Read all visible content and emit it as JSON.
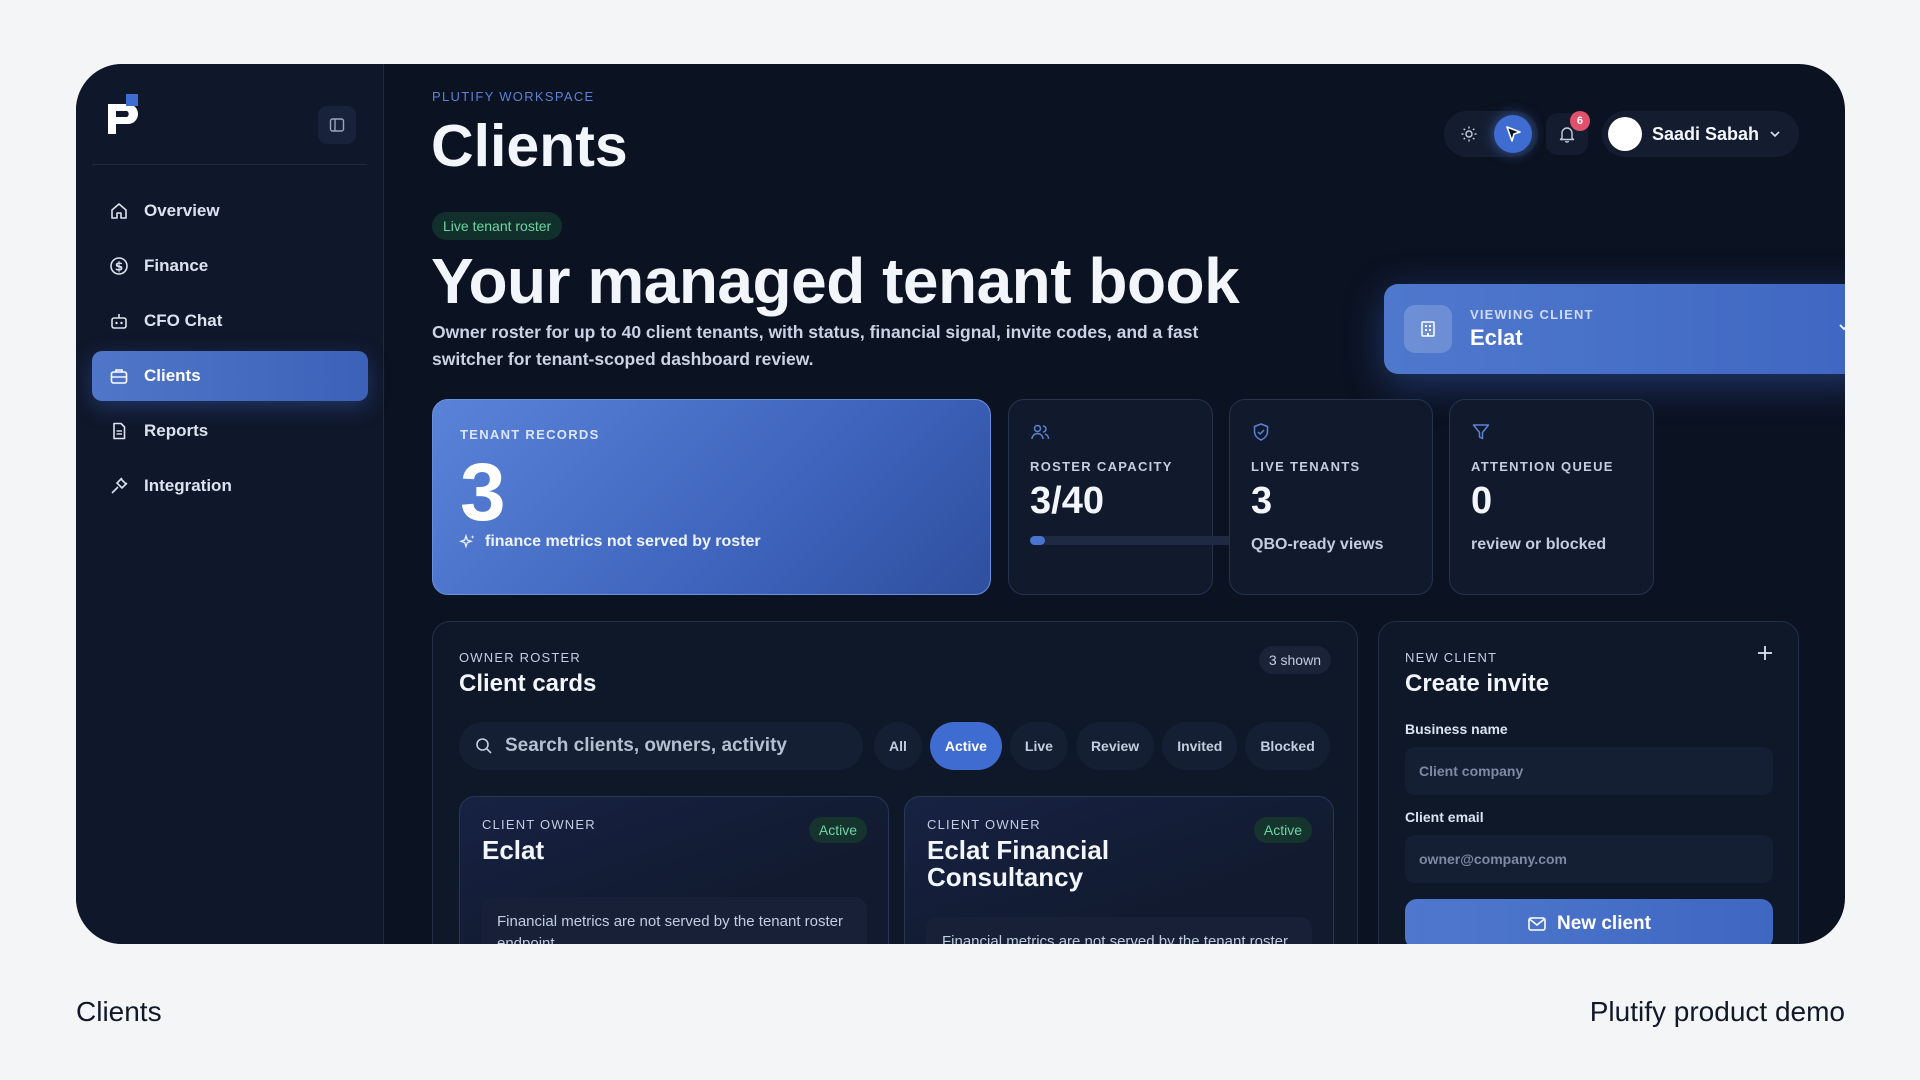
{
  "sidebar": {
    "items": [
      {
        "label": "Overview",
        "icon": "home-icon"
      },
      {
        "label": "Finance",
        "icon": "dollar-icon"
      },
      {
        "label": "CFO Chat",
        "icon": "bot-icon"
      },
      {
        "label": "Clients",
        "icon": "briefcase-icon",
        "active": true
      },
      {
        "label": "Reports",
        "icon": "document-icon"
      },
      {
        "label": "Integration",
        "icon": "plug-icon"
      }
    ]
  },
  "header": {
    "workspace": "PLUTIFY WORKSPACE",
    "title": "Clients",
    "notifications": "6",
    "user_name": "Saadi Sabah"
  },
  "hero": {
    "chip": "Live tenant roster",
    "title": "Your managed tenant book",
    "description": "Owner roster for up to 40 client tenants, with status, financial signal, invite codes, and a fast switcher for tenant-scoped dashboard review."
  },
  "viewing_client": {
    "label": "VIEWING CLIENT",
    "value": "Eclat"
  },
  "stats": {
    "tenant_records": {
      "label": "TENANT RECORDS",
      "value": "3",
      "sub": "finance metrics not served by roster"
    },
    "roster_capacity": {
      "label": "ROSTER CAPACITY",
      "value": "3/40",
      "progress": 0.075
    },
    "live_tenants": {
      "label": "LIVE TENANTS",
      "value": "3",
      "sub": "QBO-ready views"
    },
    "attention_queue": {
      "label": "ATTENTION QUEUE",
      "value": "0",
      "sub": "review or blocked"
    }
  },
  "roster": {
    "eyebrow": "OWNER ROSTER",
    "title": "Client cards",
    "shown": "3 shown",
    "search_placeholder": "Search clients, owners, activity",
    "filters": [
      "All",
      "Active",
      "Live",
      "Review",
      "Invited",
      "Blocked"
    ],
    "active_filter": "Active",
    "cards": [
      {
        "eyebrow": "CLIENT OWNER",
        "name": "Eclat",
        "status": "Active",
        "note": "Financial metrics are not served by the tenant roster endpoint."
      },
      {
        "eyebrow": "CLIENT OWNER",
        "name": "Eclat Financial Consultancy",
        "status": "Active",
        "note": "Financial metrics are not served by the tenant roster endpoint."
      }
    ]
  },
  "invite": {
    "eyebrow": "NEW CLIENT",
    "title": "Create invite",
    "business_label": "Business name",
    "business_placeholder": "Client company",
    "email_label": "Client email",
    "email_placeholder": "owner@company.com",
    "button": "New client"
  },
  "captions": {
    "left": "Clients",
    "right": "Plutify product demo"
  },
  "colors": {
    "accent": "#3f6cd0",
    "background": "#0b1221",
    "success": "#6fd3a4",
    "alert": "#e0516b"
  }
}
